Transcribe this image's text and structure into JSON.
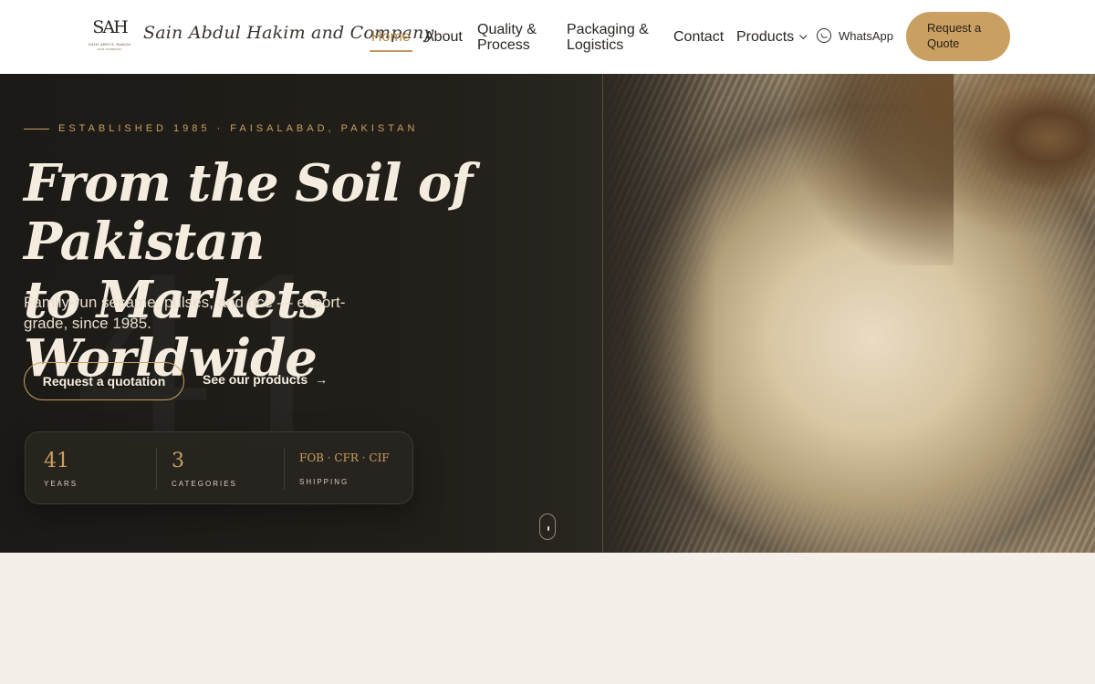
{
  "brand": {
    "monogram": "SAH",
    "logo_tiny": "SAIN ABDUL HAKIM",
    "logo_tiny2": "AND COMPANY",
    "name": "Sain Abdul Hakim and Company"
  },
  "nav": {
    "items": [
      {
        "label": "Home",
        "active": true
      },
      {
        "label": "About"
      },
      {
        "label": "Quality & Process"
      },
      {
        "label": "Packaging & Logistics"
      },
      {
        "label": "Contact"
      },
      {
        "label": "Products"
      }
    ],
    "whatsapp": "WhatsApp",
    "quote_button": "Request a Quote"
  },
  "hero": {
    "eyebrow": "ESTABLISHED 1985 · FAISALABAD, PAKISTAN",
    "headline_line1": "From the Soil of Pakistan",
    "headline_line2": "to Markets Worldwide",
    "subtitle": "Family-run sesame, pulses, and rice — export-grade, since 1985.",
    "watermark": "41",
    "primary_cta": "Request a quotation",
    "secondary_cta": "See our products",
    "secondary_arrow": "→"
  },
  "stats": [
    {
      "value": "41",
      "label": "YEARS"
    },
    {
      "value": "3",
      "label": "CATEGORIES"
    },
    {
      "value": "FOB · CFR · CIF",
      "label": "SHIPPING"
    }
  ],
  "colors": {
    "accent": "#c9a061",
    "hero_bg": "#1c1a17",
    "page_bg": "#f5efe9"
  }
}
